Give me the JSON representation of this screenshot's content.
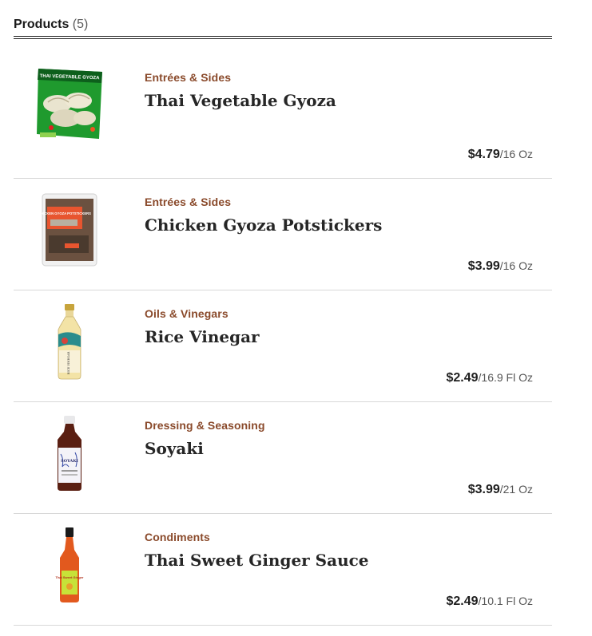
{
  "header": {
    "title": "Products",
    "count": "(5)"
  },
  "products": [
    {
      "category": "Entrées & Sides",
      "name": "Thai Vegetable Gyoza",
      "price": "$4.79",
      "unit": "/16 Oz",
      "image_label": "THAI VEGETABLE GYOZA"
    },
    {
      "category": "Entrées & Sides",
      "name": "Chicken Gyoza Potstickers",
      "price": "$3.99",
      "unit": "/16 Oz",
      "image_label": "CHICKEN GYOZA POTSTICKERS"
    },
    {
      "category": "Oils & Vinegars",
      "name": "Rice Vinegar",
      "price": "$2.49",
      "unit": "/16.9 Fl Oz",
      "image_label": "RICE VINEGAR"
    },
    {
      "category": "Dressing & Seasoning",
      "name": "Soyaki",
      "price": "$3.99",
      "unit": "/21 Oz",
      "image_label": "SOYAKI"
    },
    {
      "category": "Condiments",
      "name": "Thai Sweet Ginger Sauce",
      "price": "$2.49",
      "unit": "/10.1 Fl Oz",
      "image_label": "Thai Sweet Ginger"
    }
  ]
}
